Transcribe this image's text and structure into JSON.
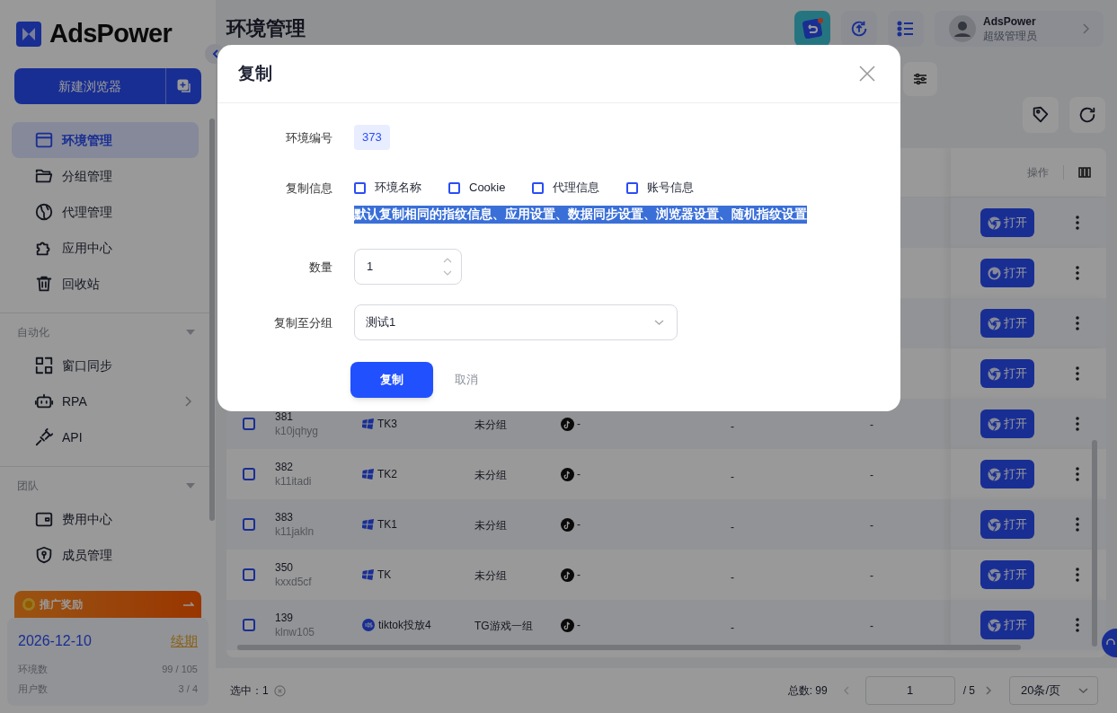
{
  "sidebar": {
    "logo": "AdsPower",
    "new_browser_button": "新建浏览器",
    "items": [
      {
        "kind": "item",
        "label": "环境管理",
        "selected": true
      },
      {
        "kind": "item",
        "label": "分组管理",
        "selected": false
      },
      {
        "kind": "item",
        "label": "代理管理",
        "selected": false
      },
      {
        "kind": "item",
        "label": "应用中心",
        "selected": false
      },
      {
        "kind": "item",
        "label": "回收站",
        "selected": false
      },
      {
        "kind": "section",
        "label": "自动化",
        "expanded": true
      },
      {
        "kind": "item",
        "label": "窗口同步",
        "selected": false
      },
      {
        "kind": "item",
        "label": "RPA",
        "selected": false,
        "submenu": true
      },
      {
        "kind": "item",
        "label": "API",
        "selected": false
      },
      {
        "kind": "section",
        "label": "团队",
        "expanded": true
      },
      {
        "kind": "item",
        "label": "费用中心",
        "selected": false
      },
      {
        "kind": "item",
        "label": "成员管理",
        "selected": false
      }
    ],
    "promo": "推广奖励",
    "plan": {
      "date": "2026-12-10",
      "renew_link": "续期",
      "stats": [
        {
          "label": "环境数",
          "value": "99 / 105"
        },
        {
          "label": "用户数",
          "value": "3 / 4"
        }
      ]
    }
  },
  "header": {
    "title": "环境管理",
    "user": {
      "name": "AdsPower",
      "role": "超级管理员"
    }
  },
  "table": {
    "action_column": "操作",
    "rows": [
      {
        "open_label": "打开"
      },
      {
        "open_label": "打开"
      },
      {
        "open_label": "打开"
      },
      {
        "open_label": "打开"
      },
      {
        "checked": false,
        "id": "381",
        "code": "k10jqhyg",
        "name": "TK3",
        "group": "未分组",
        "platform": "-",
        "column_6": "-",
        "column_7": "-",
        "open_label": "打开"
      },
      {
        "checked": false,
        "id": "382",
        "code": "k11itadi",
        "name": "TK2",
        "group": "未分组",
        "platform": "-",
        "column_6": "-",
        "column_7": "-",
        "open_label": "打开"
      },
      {
        "checked": false,
        "id": "383",
        "code": "k11jakln",
        "name": "TK1",
        "group": "未分组",
        "platform": "-",
        "column_6": "-",
        "column_7": "-",
        "open_label": "打开"
      },
      {
        "checked": false,
        "id": "350",
        "code": "kxxd5cf",
        "name": "TK",
        "group": "未分组",
        "platform": "-",
        "column_6": "-",
        "column_7": "-",
        "open_label": "打开"
      },
      {
        "checked": false,
        "id": "139",
        "code": "klnw105",
        "name": "tiktok投放4",
        "group": "TG游戏一组",
        "platform": "-",
        "column_6": "-",
        "column_7": "-",
        "open_label": "打开"
      }
    ]
  },
  "footer": {
    "selected_label": "选中：1",
    "total": "总数: 99",
    "page": "1",
    "pages": "/ 5",
    "page_size": "20条/页"
  },
  "dialog": {
    "title": "复制",
    "env_label": "环境编号",
    "env_value": "373",
    "copy_label": "复制信息",
    "options": [
      {
        "label": "环境名称",
        "checked": false
      },
      {
        "label": "Cookie",
        "checked": false
      },
      {
        "label": "代理信息",
        "checked": false
      },
      {
        "label": "账号信息",
        "checked": false
      }
    ],
    "note": "默认复制相同的指纹信息、应用设置、数据同步设置、浏览器设置、随机指纹设置",
    "count_label": "数量",
    "count_value": "1",
    "group_label": "复制至分组",
    "group_value": "测试1",
    "confirm": "复制",
    "cancel": "取消"
  }
}
